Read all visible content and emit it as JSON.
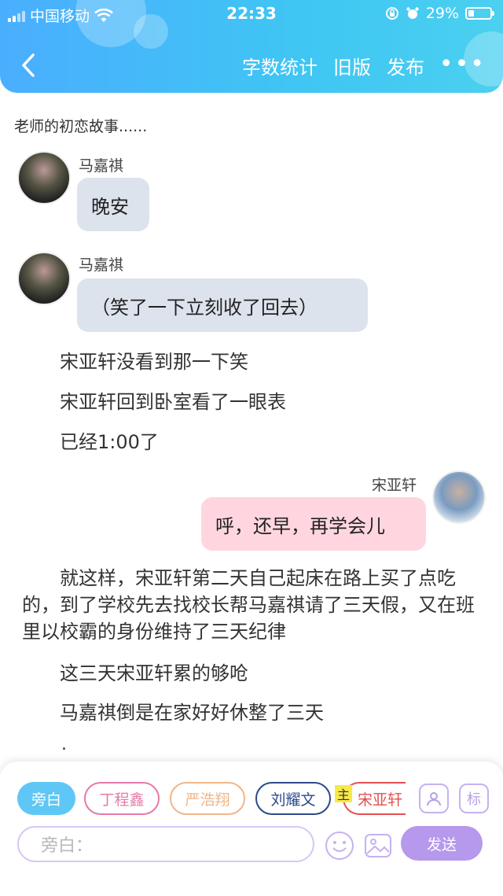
{
  "status_bar": {
    "carrier": "中国移动",
    "time": "22:33",
    "battery": "29%",
    "battery_level": 0.29
  },
  "nav": {
    "actions": [
      "字数统计",
      "旧版",
      "发布"
    ],
    "more": "•••"
  },
  "story": {
    "title": "老师的初恋故事......",
    "messages": [
      {
        "speaker": "马嘉祺",
        "text": "晚安"
      },
      {
        "speaker": "马嘉祺",
        "text": "（笑了一下立刻收了回去）"
      }
    ],
    "narration_1": [
      "宋亚轩没看到那一下笑",
      "宋亚轩回到卧室看了一眼表",
      "已经1:00了"
    ],
    "reply": {
      "speaker": "宋亚轩",
      "text": "呼，还早，再学会儿"
    },
    "paragraph": "就这样，宋亚轩第二天自己起床在路上买了点吃的，到了学校先去找校长帮马嘉祺请了三天假，又在班里以校霸的身份维持了三天纪律",
    "narration_2": [
      "这三天宋亚轩累的够呛",
      "马嘉祺倒是在家好好休整了三天"
    ],
    "trailing": "."
  },
  "composer": {
    "chips": [
      {
        "label": "旁白",
        "color": "#5ec7f5",
        "active": true
      },
      {
        "label": "丁程鑫",
        "color": "#e77aa8",
        "active": false
      },
      {
        "label": "严浩翔",
        "color": "#f1b58a",
        "active": false
      },
      {
        "label": "刘耀文",
        "color": "#2c4a8a",
        "active": false
      },
      {
        "label": "宋亚轩",
        "color": "#e45050",
        "active": false
      }
    ],
    "main_badge": "主",
    "tag_label": "标",
    "placeholder": "旁白：",
    "send_label": "发送",
    "icons": [
      "person-icon",
      "emoji-icon",
      "image-icon",
      "wifi-icon",
      "back-icon"
    ]
  }
}
